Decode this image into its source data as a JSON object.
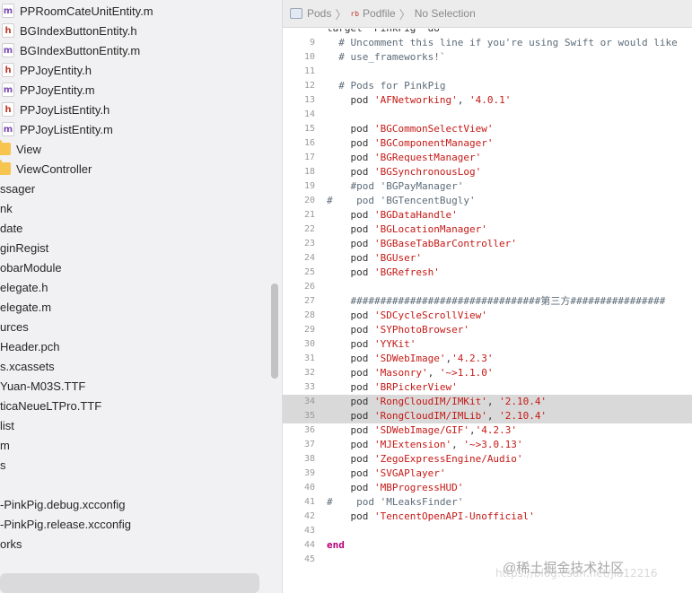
{
  "navigator": {
    "items": [
      {
        "label": "PPRoomCateUnitEntity.m",
        "kind": "m",
        "indent": true
      },
      {
        "label": "BGIndexButtonEntity.h",
        "kind": "h",
        "indent": true
      },
      {
        "label": "BGIndexButtonEntity.m",
        "kind": "m",
        "indent": true
      },
      {
        "label": "PPJoyEntity.h",
        "kind": "h",
        "indent": true
      },
      {
        "label": "PPJoyEntity.m",
        "kind": "m",
        "indent": true
      },
      {
        "label": "PPJoyListEntity.h",
        "kind": "h",
        "indent": true
      },
      {
        "label": "PPJoyListEntity.m",
        "kind": "m",
        "indent": true
      },
      {
        "label": "View",
        "kind": "folder",
        "indent": false
      },
      {
        "label": "ViewController",
        "kind": "folder",
        "indent": false
      },
      {
        "label": "ssager",
        "kind": "plain",
        "indent": false
      },
      {
        "label": "nk",
        "kind": "plain",
        "indent": false
      },
      {
        "label": "date",
        "kind": "plain",
        "indent": false
      },
      {
        "label": "ginRegist",
        "kind": "plain",
        "indent": false
      },
      {
        "label": "obarModule",
        "kind": "plain",
        "indent": false
      },
      {
        "label": "elegate.h",
        "kind": "plain",
        "indent": false
      },
      {
        "label": "elegate.m",
        "kind": "plain",
        "indent": false
      },
      {
        "label": "urces",
        "kind": "plain",
        "indent": false
      },
      {
        "label": "Header.pch",
        "kind": "plain",
        "indent": false
      },
      {
        "label": "s.xcassets",
        "kind": "plain",
        "indent": false
      },
      {
        "label": "Yuan-M03S.TTF",
        "kind": "plain",
        "indent": false
      },
      {
        "label": "ticaNeueLTPro.TTF",
        "kind": "plain",
        "indent": false
      },
      {
        "label": "list",
        "kind": "plain",
        "indent": false
      },
      {
        "label": "m",
        "kind": "plain",
        "indent": false
      },
      {
        "label": "s",
        "kind": "plain",
        "indent": false
      },
      {
        "label": "",
        "kind": "blank",
        "indent": false
      },
      {
        "label": "-PinkPig.debug.xcconfig",
        "kind": "plain",
        "indent": false
      },
      {
        "label": "-PinkPig.release.xcconfig",
        "kind": "plain",
        "indent": false
      },
      {
        "label": "orks",
        "kind": "plain",
        "indent": false
      }
    ]
  },
  "jumpbar": {
    "pods_label": "Pods",
    "file_badge": "rb",
    "file_label": "Podfile",
    "selection_label": "No Selection",
    "separator": "〉"
  },
  "editor": {
    "partial_top_line": "target 'PinkPig' do",
    "lines": [
      {
        "n": "9",
        "tokens": [
          {
            "t": "  # Uncomment this line if you're using Swift or would like",
            "c": "cmt"
          }
        ]
      },
      {
        "n": "10",
        "tokens": [
          {
            "t": "  # use_frameworks!`",
            "c": "cmt"
          }
        ]
      },
      {
        "n": "11",
        "tokens": []
      },
      {
        "n": "12",
        "tokens": [
          {
            "t": "  # Pods for PinkPig",
            "c": "cmt"
          }
        ]
      },
      {
        "n": "13",
        "tokens": [
          {
            "t": "    pod ",
            "c": ""
          },
          {
            "t": "'AFNetworking'",
            "c": "str"
          },
          {
            "t": ", ",
            "c": ""
          },
          {
            "t": "'4.0.1'",
            "c": "str"
          }
        ]
      },
      {
        "n": "14",
        "tokens": []
      },
      {
        "n": "15",
        "tokens": [
          {
            "t": "    pod ",
            "c": ""
          },
          {
            "t": "'BGCommonSelectView'",
            "c": "str"
          }
        ]
      },
      {
        "n": "16",
        "tokens": [
          {
            "t": "    pod ",
            "c": ""
          },
          {
            "t": "'BGComponentManager'",
            "c": "str"
          }
        ]
      },
      {
        "n": "17",
        "tokens": [
          {
            "t": "    pod ",
            "c": ""
          },
          {
            "t": "'BGRequestManager'",
            "c": "str"
          }
        ]
      },
      {
        "n": "18",
        "tokens": [
          {
            "t": "    pod ",
            "c": ""
          },
          {
            "t": "'BGSynchronousLog'",
            "c": "str"
          }
        ]
      },
      {
        "n": "19",
        "tokens": [
          {
            "t": "    #pod 'BGPayManager'",
            "c": "cmt"
          }
        ]
      },
      {
        "n": "20",
        "tokens": [
          {
            "t": "#    pod 'BGTencentBugly'",
            "c": "cmt"
          }
        ]
      },
      {
        "n": "21",
        "tokens": [
          {
            "t": "    pod ",
            "c": ""
          },
          {
            "t": "'BGDataHandle'",
            "c": "str"
          }
        ]
      },
      {
        "n": "22",
        "tokens": [
          {
            "t": "    pod ",
            "c": ""
          },
          {
            "t": "'BGLocationManager'",
            "c": "str"
          }
        ]
      },
      {
        "n": "23",
        "tokens": [
          {
            "t": "    pod ",
            "c": ""
          },
          {
            "t": "'BGBaseTabBarController'",
            "c": "str"
          }
        ]
      },
      {
        "n": "24",
        "tokens": [
          {
            "t": "    pod ",
            "c": ""
          },
          {
            "t": "'BGUser'",
            "c": "str"
          }
        ]
      },
      {
        "n": "25",
        "tokens": [
          {
            "t": "    pod ",
            "c": ""
          },
          {
            "t": "'BGRefresh'",
            "c": "str"
          }
        ]
      },
      {
        "n": "26",
        "tokens": []
      },
      {
        "n": "27",
        "tokens": [
          {
            "t": "    ################################第三方################",
            "c": "cmt"
          }
        ]
      },
      {
        "n": "28",
        "tokens": [
          {
            "t": "    pod ",
            "c": ""
          },
          {
            "t": "'SDCycleScrollView'",
            "c": "str"
          }
        ]
      },
      {
        "n": "29",
        "tokens": [
          {
            "t": "    pod ",
            "c": ""
          },
          {
            "t": "'SYPhotoBrowser'",
            "c": "str"
          }
        ]
      },
      {
        "n": "30",
        "tokens": [
          {
            "t": "    pod ",
            "c": ""
          },
          {
            "t": "'YYKit'",
            "c": "str"
          }
        ]
      },
      {
        "n": "31",
        "tokens": [
          {
            "t": "    pod ",
            "c": ""
          },
          {
            "t": "'SDWebImage'",
            "c": "str"
          },
          {
            "t": ",",
            "c": ""
          },
          {
            "t": "'4.2.3'",
            "c": "str"
          }
        ]
      },
      {
        "n": "32",
        "tokens": [
          {
            "t": "    pod ",
            "c": ""
          },
          {
            "t": "'Masonry'",
            "c": "str"
          },
          {
            "t": ", ",
            "c": ""
          },
          {
            "t": "'~>1.1.0'",
            "c": "str"
          }
        ]
      },
      {
        "n": "33",
        "tokens": [
          {
            "t": "    pod ",
            "c": ""
          },
          {
            "t": "'BRPickerView'",
            "c": "str"
          }
        ]
      },
      {
        "n": "34",
        "hl": true,
        "tokens": [
          {
            "t": "    pod ",
            "c": ""
          },
          {
            "t": "'RongCloudIM/IMKit'",
            "c": "str"
          },
          {
            "t": ", ",
            "c": ""
          },
          {
            "t": "'2.10.4'",
            "c": "str"
          }
        ]
      },
      {
        "n": "35",
        "hl": true,
        "tokens": [
          {
            "t": "    pod ",
            "c": ""
          },
          {
            "t": "'RongCloudIM/IMLib'",
            "c": "str"
          },
          {
            "t": ", ",
            "c": ""
          },
          {
            "t": "'2.10.4'",
            "c": "str"
          }
        ]
      },
      {
        "n": "36",
        "tokens": [
          {
            "t": "    pod ",
            "c": ""
          },
          {
            "t": "'SDWebImage/GIF'",
            "c": "str"
          },
          {
            "t": ",",
            "c": ""
          },
          {
            "t": "'4.2.3'",
            "c": "str"
          }
        ]
      },
      {
        "n": "37",
        "tokens": [
          {
            "t": "    pod ",
            "c": ""
          },
          {
            "t": "'MJExtension'",
            "c": "str"
          },
          {
            "t": ", ",
            "c": ""
          },
          {
            "t": "'~>3.0.13'",
            "c": "str"
          }
        ]
      },
      {
        "n": "38",
        "tokens": [
          {
            "t": "    pod ",
            "c": ""
          },
          {
            "t": "'ZegoExpressEngine/Audio'",
            "c": "str"
          }
        ]
      },
      {
        "n": "39",
        "tokens": [
          {
            "t": "    pod ",
            "c": ""
          },
          {
            "t": "'SVGAPlayer'",
            "c": "str"
          }
        ]
      },
      {
        "n": "40",
        "tokens": [
          {
            "t": "    pod ",
            "c": ""
          },
          {
            "t": "'MBProgressHUD'",
            "c": "str"
          }
        ]
      },
      {
        "n": "41",
        "tokens": [
          {
            "t": "#    pod 'MLeaksFinder'",
            "c": "cmt"
          }
        ]
      },
      {
        "n": "42",
        "tokens": [
          {
            "t": "    pod ",
            "c": ""
          },
          {
            "t": "'TencentOpenAPI-Unofficial'",
            "c": "str"
          }
        ]
      },
      {
        "n": "43",
        "tokens": []
      },
      {
        "n": "44",
        "tokens": [
          {
            "t": "end",
            "c": "kw"
          }
        ]
      },
      {
        "n": "45",
        "tokens": []
      }
    ]
  },
  "watermark": {
    "text": "@稀土掘金技术社区",
    "sub_text": "https://blog.csdn.net/jia12216"
  },
  "colors": {
    "comment": "#5d6c79",
    "string": "#c41a16",
    "keyword": "#b5007a",
    "highlight": "#d9d9d9",
    "navigator_bg": "#f1f1f3"
  }
}
